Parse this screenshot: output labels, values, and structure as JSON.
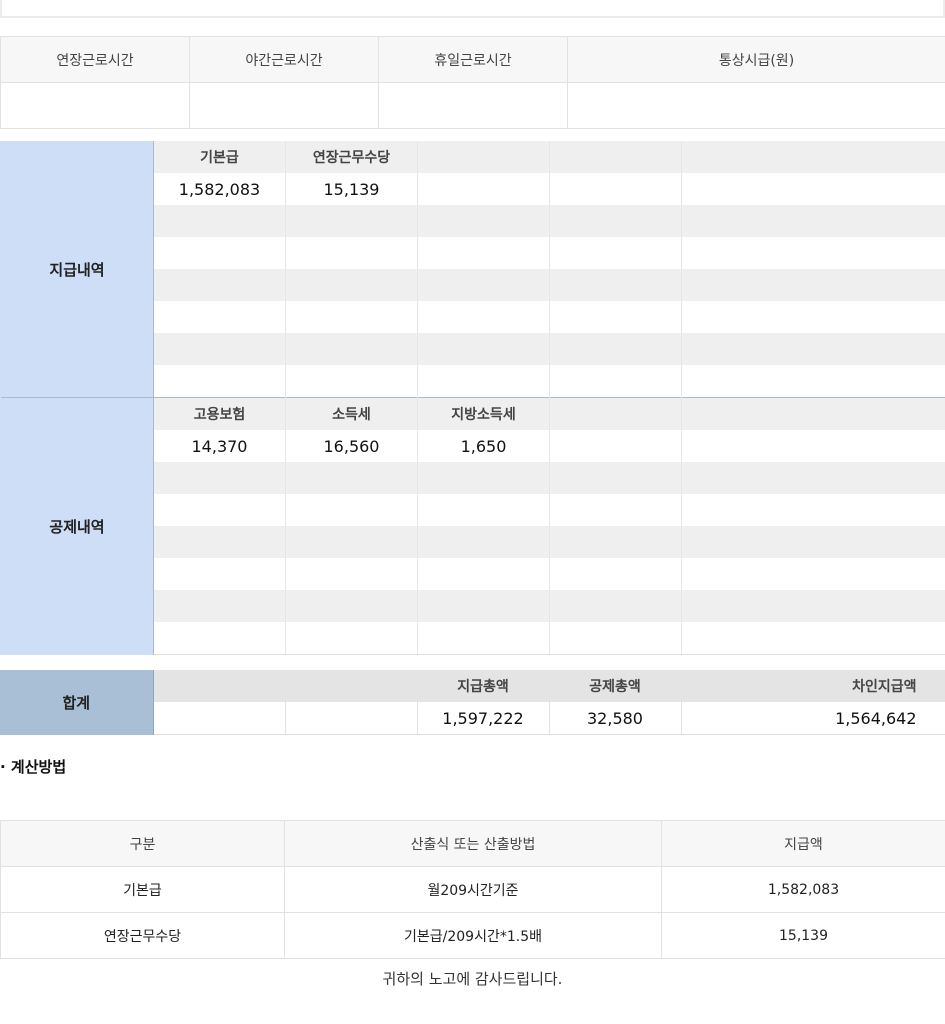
{
  "hours_table": {
    "headers": [
      "연장근로시간",
      "야간근로시간",
      "휴일근로시간",
      "통상시급(원)"
    ],
    "values": [
      "",
      "",
      "",
      ""
    ]
  },
  "payments": {
    "label": "지급내역",
    "headers": [
      "기본급",
      "연장근무수당",
      "",
      "",
      ""
    ],
    "values": [
      "1,582,083",
      "15,139",
      "",
      "",
      ""
    ]
  },
  "deductions": {
    "label": "공제내역",
    "headers": [
      "고용보험",
      "소득세",
      "지방소득세",
      "",
      ""
    ],
    "values": [
      "14,370",
      "16,560",
      "1,650",
      "",
      ""
    ]
  },
  "totals": {
    "label": "합계",
    "headers": [
      "",
      "",
      "지급총액",
      "공제총액",
      "차인지급액"
    ],
    "values": [
      "",
      "",
      "1,597,222",
      "32,580",
      "1,564,642"
    ]
  },
  "calc": {
    "title": "· 계산방법",
    "headers": [
      "구분",
      "산출식 또는 산출방법",
      "지급액"
    ],
    "rows": [
      [
        "기본급",
        "월209시간기준",
        "1,582,083"
      ],
      [
        "연장근무수당",
        "기본급/209시간*1.5배",
        "15,139"
      ]
    ]
  },
  "footer": {
    "thanks": "귀하의 노고에 감사드립니다."
  }
}
